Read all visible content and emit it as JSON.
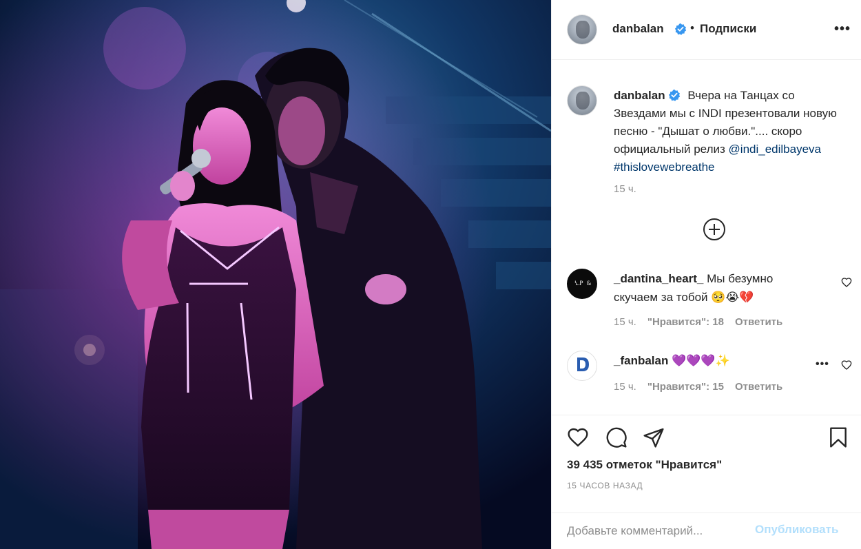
{
  "header": {
    "username": "danbalan",
    "separator": "•",
    "follow_label": "Подписки",
    "more_label": "•••"
  },
  "caption": {
    "username": "danbalan",
    "text": "Вчера на Танцах со Звездами мы с INDI презентовали новую песню - \"Дышат о любви.\".... скоро официальный релиз",
    "mention": "@indi_edilbayeva",
    "hashtag": "#thislovewebreathe",
    "time": "15 ч."
  },
  "comments": [
    {
      "username": "_dantina_heart_",
      "text": "Мы безумно скучаем за тобой 🥺😭💔",
      "time": "15 ч.",
      "likes": "\"Нравится\": 18",
      "reply": "Ответить"
    },
    {
      "username": "_fanbalan",
      "text": "💜💜💜✨",
      "time": "15 ч.",
      "likes": "\"Нравится\": 15",
      "reply": "Ответить",
      "more_label": "•••"
    }
  ],
  "post": {
    "likes_count": "39 435 отметок \"Нравится\"",
    "posted_ago": "15 ЧАСОВ НАЗАД"
  },
  "comment_box": {
    "placeholder": "Добавьте комментарий...",
    "publish_label": "Опубликовать"
  },
  "icons": {
    "verified": "verified-badge-icon",
    "load_more": "plus-circle-icon",
    "like": "heart-icon",
    "comment": "comment-bubble-icon",
    "share": "paper-plane-icon",
    "save": "bookmark-icon"
  },
  "colors": {
    "verified_blue": "#3897f0",
    "link": "#00376b",
    "muted": "#8e8e8e",
    "publish_disabled": "#b2dffc"
  }
}
